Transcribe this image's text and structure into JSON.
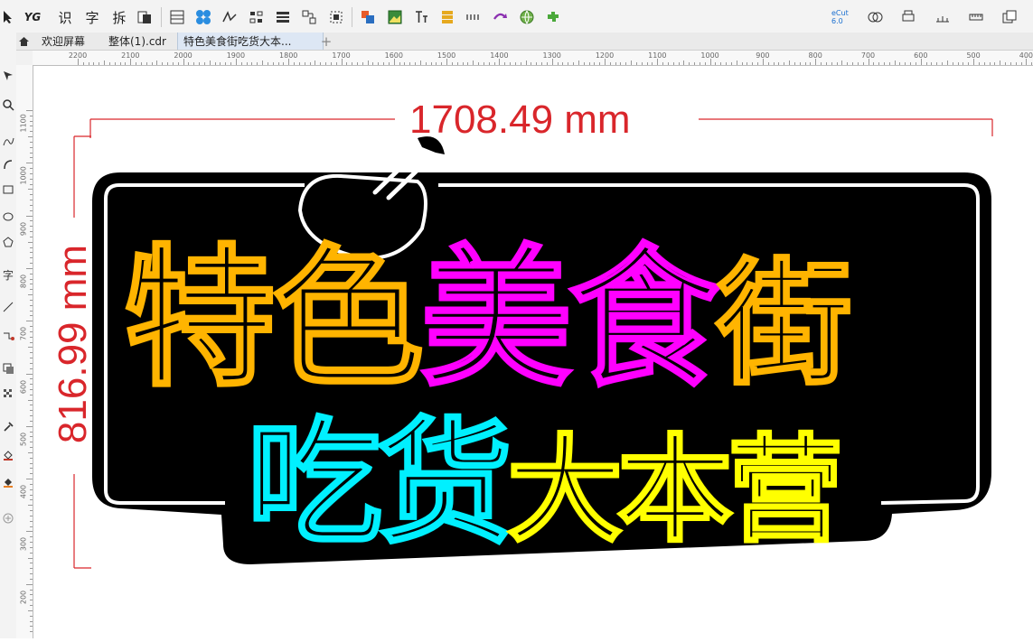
{
  "toolbar": {
    "items": [
      {
        "name": "pointer-icon"
      },
      {
        "name": "yg-plugin-icon",
        "label": "YG"
      },
      {
        "name": "recognize-tool",
        "label": "识"
      },
      {
        "name": "text-tool",
        "label": "字"
      },
      {
        "name": "split-tool",
        "label": "拆"
      },
      {
        "name": "copy-icon"
      },
      {
        "name": "table-icon"
      },
      {
        "name": "pattern-icon"
      },
      {
        "name": "path-icon"
      },
      {
        "name": "align-icon"
      },
      {
        "name": "distribute-icon"
      },
      {
        "name": "group-icon"
      },
      {
        "name": "select-frame-icon"
      },
      {
        "name": "arrange-icon"
      },
      {
        "name": "image-icon"
      },
      {
        "name": "text-format-icon"
      },
      {
        "name": "list-icon"
      },
      {
        "name": "grid-icon"
      },
      {
        "name": "arrow-icon"
      },
      {
        "name": "globe-icon"
      },
      {
        "name": "puzzle-icon"
      }
    ],
    "right_items": [
      {
        "name": "ecut-icon",
        "label": "eCut 6.0"
      },
      {
        "name": "shape-icon"
      },
      {
        "name": "print-icon"
      },
      {
        "name": "measure-icon"
      },
      {
        "name": "ruler-icon"
      },
      {
        "name": "window-icon"
      }
    ]
  },
  "tabs": [
    {
      "label": "欢迎屏幕",
      "active": false
    },
    {
      "label": "整体(1).cdr",
      "active": false
    },
    {
      "label": "特色美食街吃货大本...",
      "active": true
    },
    {
      "label": "+",
      "active": false
    }
  ],
  "ruler": {
    "h_labels": [
      "2200",
      "2100",
      "2000",
      "1900",
      "1800",
      "1700",
      "1600",
      "1500",
      "1400",
      "1300",
      "1200",
      "1100",
      "1000",
      "900",
      "800",
      "700",
      "600",
      "500",
      "400"
    ],
    "v_labels": [
      "1100",
      "1000",
      "900",
      "800",
      "700",
      "600",
      "500",
      "400",
      "300",
      "200"
    ]
  },
  "drawing": {
    "width_dimension": "1708.49 mm",
    "height_dimension": "816.99 mm",
    "line1": [
      {
        "text": "特色",
        "color": "#ffb400"
      },
      {
        "text": "美食",
        "color": "#ff00ff"
      },
      {
        "text": "街",
        "color": "#ffb400"
      }
    ],
    "line2": [
      {
        "text": "吃货",
        "color": "#00f0ff"
      },
      {
        "text": "大本营",
        "color": "#ffff00"
      }
    ],
    "dimension_color": "#d9262b"
  }
}
